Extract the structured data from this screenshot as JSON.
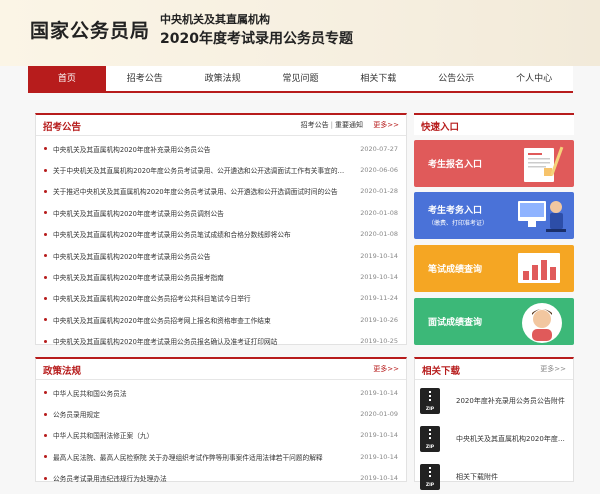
{
  "header": {
    "logo": "国家公务员局",
    "subtitle1": "中央机关及其直属机构",
    "subtitle2": "2020年度考试录用公务员专题"
  },
  "nav": [
    "首页",
    "招考公告",
    "政策法规",
    "常见问题",
    "相关下载",
    "公告公示",
    "个人中心"
  ],
  "announce": {
    "title": "招考公告",
    "links": [
      "招考公告",
      "重要通知"
    ],
    "more": "更多>>",
    "items": [
      {
        "text": "中央机关及其直属机构2020年度补充录用公务员公告",
        "date": "2020-07-27"
      },
      {
        "text": "关于中央机关及其直属机构2020年度公务员考试录用、公开遴选和公开选调面试工作有关事宜的公告",
        "date": "2020-06-06"
      },
      {
        "text": "关于推迟中央机关及其直属机构2020年度公务员考试录用、公开遴选和公开选调面试时间的公告",
        "date": "2020-01-28"
      },
      {
        "text": "中央机关及其直属机构2020年度考试录用公务员调剂公告",
        "date": "2020-01-08"
      },
      {
        "text": "中央机关及其直属机构2020年度考试录用公务员笔试成绩和合格分数线即将公布",
        "date": "2020-01-08"
      },
      {
        "text": "中央机关及其直属机构2020年度考试录用公务员公告",
        "date": "2019-10-14"
      },
      {
        "text": "中央机关及其直属机构2020年度考试录用公务员报考指南",
        "date": "2019-10-14"
      },
      {
        "text": "中央机关及其直属机构2020年度公务员招考公共科目笔试今日举行",
        "date": "2019-11-24"
      },
      {
        "text": "中央机关及其直属机构2020年度公务员招考网上报名和资格审查工作结束",
        "date": "2019-10-26"
      },
      {
        "text": "中央机关及其直属机构2020年度考试录用公务员报名确认及准考证打印网站",
        "date": "2019-10-25"
      }
    ]
  },
  "policy": {
    "title": "政策法规",
    "more": "更多>>",
    "items": [
      {
        "text": "中华人民共和国公务员法",
        "date": "2019-10-14"
      },
      {
        "text": "公务员录用规定",
        "date": "2020-01-09"
      },
      {
        "text": "中华人民共和国刑法修正案（九）",
        "date": "2019-10-14"
      },
      {
        "text": "最高人民法院、最高人民检察院 关于办理组织考试作弊等刑事案件适用法律若干问题的解释",
        "date": "2019-10-14"
      },
      {
        "text": "公务员考试录用违纪违规行为处理办法",
        "date": "2019-10-14"
      }
    ]
  },
  "quick": {
    "title": "快速入口",
    "items": [
      {
        "label": "考生报名入口",
        "sub": "",
        "color": "#e05a5a"
      },
      {
        "label": "考生考务入口",
        "sub": "（缴费、打印准考证）",
        "color": "#4a72d8"
      },
      {
        "label": "笔试成绩查询",
        "sub": "",
        "color": "#f5a623"
      },
      {
        "label": "面试成绩查询",
        "sub": "",
        "color": "#3cb878"
      }
    ]
  },
  "downloads": {
    "title": "相关下载",
    "more": "更多>>",
    "items": [
      {
        "text": "2020年度补充录用公务员公告附件",
        "badge": "ZIP"
      },
      {
        "text": "中央机关及其直属机构2020年度考试录用公务员职位表",
        "badge": "ZIP"
      },
      {
        "text": "相关下载附件",
        "badge": "ZIP"
      }
    ]
  }
}
